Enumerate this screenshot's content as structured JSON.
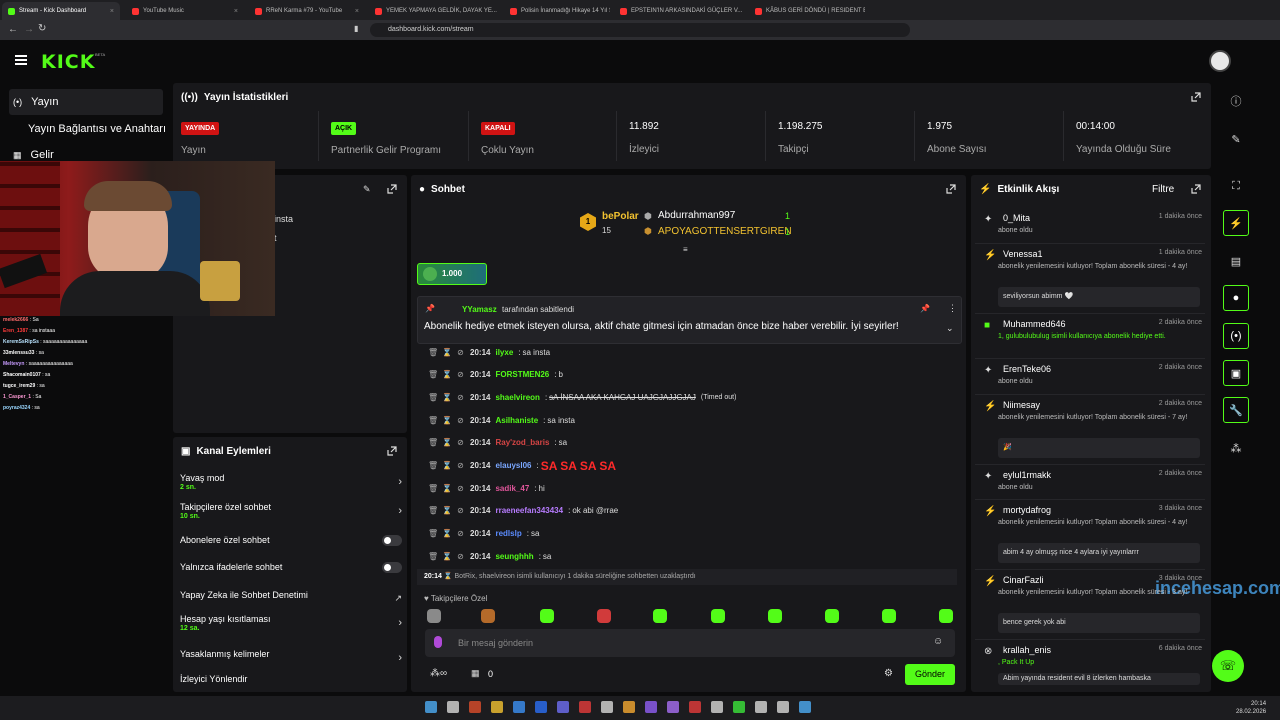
{
  "browser": {
    "tabs": [
      {
        "label": "Stream - Kick Dashboard",
        "color": "#53fc18",
        "active": true
      },
      {
        "label": "YouTube Music",
        "color": "#ff3333"
      },
      {
        "label": "RReN Karma #79 - YouTube",
        "color": "#ff3333"
      },
      {
        "label": "YEMEK YAPMAYA GELDİK, DAYAK YE...",
        "color": "#ff3333"
      },
      {
        "label": "Polisin İnanmadığı Hikaye 14 Yıl Sonra",
        "color": "#ff3333"
      },
      {
        "label": "EPSTEIN'IN ARKASINDAKİ GÜÇLER V...",
        "color": "#ff3333"
      },
      {
        "label": "KÂBUS GERİ DÖNDÜ | RESIDENT EVIL ...",
        "color": "#ff3333"
      }
    ],
    "url": "dashboard.kick.com/stream"
  },
  "brand": {
    "logo": "KICK",
    "beta": "BETA",
    "accent": "#53fc18"
  },
  "nav": {
    "items": [
      {
        "label": "Yayın",
        "icon": "broadcast-icon"
      },
      {
        "label": "Yayın Bağlantısı ve Anahtarı",
        "icon": "key-icon"
      },
      {
        "label": "Gelir",
        "icon": "chart-icon"
      }
    ]
  },
  "stats": {
    "title": "Yayın İstatistikleri",
    "items": [
      {
        "badge": "YAYINDA",
        "label": "Yayın"
      },
      {
        "badge": "AÇIK",
        "label": "Partnerlik Gelir Programı"
      },
      {
        "badge": "KAPALI",
        "label": "Çoklu Yayın"
      },
      {
        "value": "11.892",
        "label": "İzleyici"
      },
      {
        "value": "1.198.275",
        "label": "Takipçi"
      },
      {
        "value": "1.975",
        "label": "Abone Sayısı"
      },
      {
        "value": "00:14:00",
        "label": "Yayında Olduğu Süre"
      }
    ]
  },
  "preview": {
    "lines": [
      "insta",
      "t"
    ]
  },
  "chat": {
    "title": "Sohbet",
    "top": [
      {
        "name": "bePolar",
        "count": "15",
        "rank": "1"
      },
      {
        "name": "Abdurrahman997",
        "count": "1"
      },
      {
        "name": "APOYAGOTTENSERTGIREN",
        "count": "1"
      }
    ],
    "kicks": "1.000",
    "pinned": {
      "by": "YYamasz",
      "suffix": "tarafından sabitlendi",
      "text": "Abonelik hediye etmek isteyen olursa, aktif chate gitmesi için atmadan önce bize haber verebilir. İyi seyirler!"
    },
    "messages": [
      {
        "time": "20:14",
        "user": "ilyxe",
        "color": "#53fc18",
        "text": "sa insta"
      },
      {
        "time": "20:14",
        "user": "FORSTMEN26",
        "color": "#53fc18",
        "text": "b"
      },
      {
        "time": "20:14",
        "user": "shaelvireon",
        "color": "#53fc18",
        "text": "sA İNSAA AKA KAHGAJ UAJGJAJJGJAJ",
        "note": "(Timed out)"
      },
      {
        "time": "20:14",
        "user": "Asilhaniste",
        "color": "#53fc18",
        "text": "sa insta"
      },
      {
        "time": "20:14",
        "user": "Ray'zod_baris",
        "color": "#d64545",
        "text": "sa"
      },
      {
        "time": "20:14",
        "user": "elauysl06",
        "color": "#7aa7ff",
        "text": "SA SA SA SA"
      },
      {
        "time": "20:14",
        "user": "sadik_47",
        "color": "#e0569b",
        "text": "hi"
      },
      {
        "time": "20:14",
        "user": "rraeneefan343434",
        "color": "#b77cff",
        "text": "ok abi @rrae"
      },
      {
        "time": "20:14",
        "user": "redlslp",
        "color": "#5b8cff",
        "text": "sa"
      },
      {
        "time": "20:14",
        "user": "seunghhh",
        "color": "#53fc18",
        "text": "sa"
      }
    ],
    "system": {
      "time": "20:14",
      "text": "BotRix, shaelvireon isimli kullanıcıyı 1 dakika süreliğine sohbetten uzaklaştırdı"
    },
    "emote_label": "Takipçilere Özel",
    "placeholder": "Bir mesaj gönderin",
    "points": "0",
    "send": "Gönder"
  },
  "actions": {
    "title": "Kanal Eylemleri",
    "items": [
      {
        "label": "Yavaş mod",
        "sub": "2 sn."
      },
      {
        "label": "Takipçilere özel sohbet",
        "sub": "10 sn."
      },
      {
        "label": "Abonelere özel sohbet"
      },
      {
        "label": "Yalnızca ifadelerle sohbet"
      },
      {
        "label": "Yapay Zeka ile Sohbet Denetimi"
      },
      {
        "label": "Hesap yaşı kısıtlaması",
        "sub": "12 sa."
      },
      {
        "label": "Yasaklanmış kelimeler"
      },
      {
        "label": "İzleyici Yönlendir"
      }
    ]
  },
  "activity": {
    "title": "Etkinlik Akışı",
    "filter": "Filtre",
    "items": [
      {
        "name": "0_Mita",
        "time": "1 dakika önce",
        "sub": "abone oldu"
      },
      {
        "name": "Venessa1",
        "time": "1 dakika önce",
        "sub": "abonelik yenilemesini kutluyor! Toplam abonelik süresi - 4 ay!",
        "msg": "seviliyorsun abimm 🤍"
      },
      {
        "name": "Muhammed646",
        "time": "2 dakika önce",
        "sub": "1, gulubulubulug isimli kullanıcıya abonelik hediye etti."
      },
      {
        "name": "ErenTeke06",
        "time": "2 dakika önce",
        "sub": "abone oldu"
      },
      {
        "name": "Niimesay",
        "time": "2 dakika önce",
        "sub": "abonelik yenilemesini kutluyor! Toplam abonelik süresi - 7 ay!",
        "msg": "🎉"
      },
      {
        "name": "eylul1rmakk",
        "time": "2 dakika önce",
        "sub": "abone oldu"
      },
      {
        "name": "mortydafrog",
        "time": "3 dakika önce",
        "sub": "abonelik yenilemesini kutluyor! Toplam abonelik süresi - 4 ay!",
        "msg": "abim 4 ay olmuşş nice 4 aylara iyi yayınlarrr"
      },
      {
        "name": "CinarFazli",
        "time": "3 dakika önce",
        "sub": "abonelik yenilemesini kutluyor! Toplam abonelik süresi - 3 ay!",
        "msg": "bence gerek yok abi"
      },
      {
        "name": "krallah_enis",
        "time": "6 dakika önce",
        "sub": ", Pack It Up",
        "msg": "Abim yayında resident evil 8 izlerken hambaska"
      }
    ]
  },
  "overlay_chat": [
    {
      "u": "melek2666",
      "t": "Sa"
    },
    {
      "u": "Eren_1387",
      "t": "sa instaaa"
    },
    {
      "u": "KeremSsRipSs",
      "t": "saaaaaaaaaaaaaaa"
    },
    {
      "u": "33mlenssu33",
      "t": "sa"
    },
    {
      "u": "Meltevyn",
      "t": "saaaaaaaaaaaaaaa"
    },
    {
      "u": "Shacomain0107",
      "t": "sa"
    },
    {
      "u": "tugce_irem29",
      "t": "sa"
    },
    {
      "u": "1_Casper_1",
      "t": "Sa"
    },
    {
      "u": "poyraz4324",
      "t": "sa"
    }
  ],
  "watermark": "incehesap.com",
  "clock": {
    "time": "20:14",
    "date": "28.02.2026"
  }
}
